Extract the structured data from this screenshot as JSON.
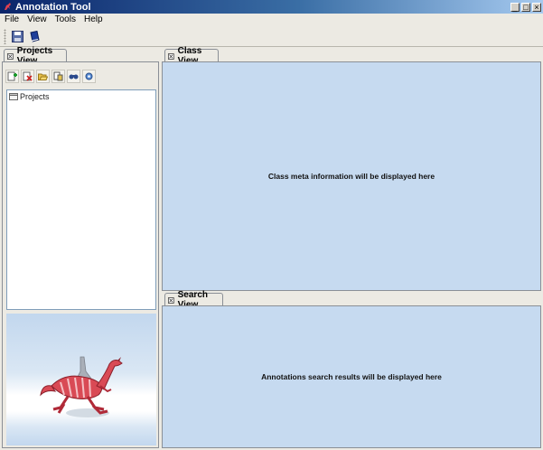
{
  "window": {
    "title": "Annotation Tool",
    "minimize_glyph": "_",
    "maximize_glyph": "□",
    "close_glyph": "×"
  },
  "menubar": {
    "items": [
      "File",
      "View",
      "Tools",
      "Help"
    ]
  },
  "toolbar": {
    "buttons": [
      "save-icon",
      "book-icon"
    ]
  },
  "projects_view": {
    "tab_label": "Projects View",
    "toolbar_buttons": [
      "add-project-icon",
      "delete-project-icon",
      "open-folder-icon",
      "export-icon",
      "find-icon",
      "settings-gear-icon"
    ],
    "tree_root": "Projects"
  },
  "class_view": {
    "tab_label": "Class View",
    "message": "Class meta information will be displayed here"
  },
  "search_view": {
    "tab_label": "Search View",
    "message": "Annotations search results will be displayed here"
  },
  "colors": {
    "title_gradient_start": "#0a246a",
    "title_gradient_end": "#a6caf0",
    "panel_background": "#c6daf0",
    "mascot_red": "#d94a55"
  }
}
